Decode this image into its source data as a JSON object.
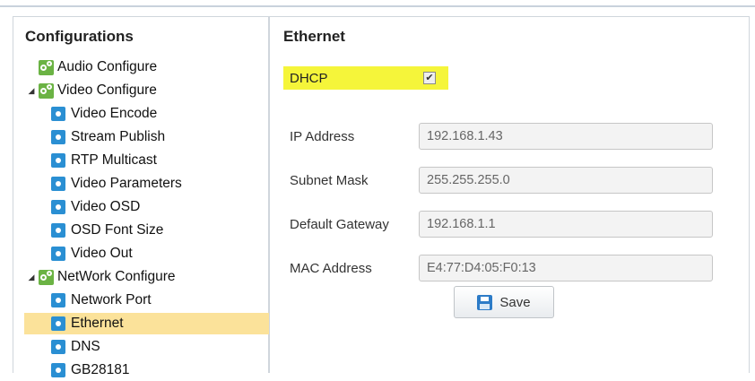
{
  "left_panel": {
    "title": "Configurations",
    "tree": [
      {
        "label": "Audio Configure",
        "icon": "gears-icon",
        "level": 0,
        "expanded": null,
        "selected": false
      },
      {
        "label": "Video Configure",
        "icon": "gears-icon",
        "level": 0,
        "expanded": true,
        "selected": false
      },
      {
        "label": "Video Encode",
        "icon": "gear-icon",
        "level": 1,
        "selected": false
      },
      {
        "label": "Stream Publish",
        "icon": "gear-icon",
        "level": 1,
        "selected": false
      },
      {
        "label": "RTP Multicast",
        "icon": "gear-icon",
        "level": 1,
        "selected": false
      },
      {
        "label": "Video Parameters",
        "icon": "gear-icon",
        "level": 1,
        "selected": false
      },
      {
        "label": "Video OSD",
        "icon": "gear-icon",
        "level": 1,
        "selected": false
      },
      {
        "label": "OSD Font Size",
        "icon": "gear-icon",
        "level": 1,
        "selected": false
      },
      {
        "label": "Video Out",
        "icon": "gear-icon",
        "level": 1,
        "selected": false
      },
      {
        "label": "NetWork Configure",
        "icon": "gears-icon",
        "level": 0,
        "expanded": true,
        "selected": false
      },
      {
        "label": "Network Port",
        "icon": "gear-icon",
        "level": 1,
        "selected": false
      },
      {
        "label": "Ethernet",
        "icon": "gear-icon",
        "level": 1,
        "selected": true
      },
      {
        "label": "DNS",
        "icon": "gear-icon",
        "level": 1,
        "selected": false
      },
      {
        "label": "GB28181",
        "icon": "gear-icon",
        "level": 1,
        "selected": false
      }
    ]
  },
  "right_panel": {
    "title": "Ethernet",
    "dhcp": {
      "label": "DHCP",
      "checked": true,
      "highlight_color": "#f5f53a"
    },
    "fields": [
      {
        "label": "IP Address",
        "value": "192.168.1.43"
      },
      {
        "label": "Subnet Mask",
        "value": "255.255.255.0"
      },
      {
        "label": "Default Gateway",
        "value": "192.168.1.1"
      },
      {
        "label": "MAC Address",
        "value": "E4:77:D4:05:F0:13"
      }
    ],
    "save_label": "Save"
  },
  "colors": {
    "selection": "#fbe29a",
    "gear_green": "#6bb344",
    "gear_blue": "#2a8fd3"
  }
}
